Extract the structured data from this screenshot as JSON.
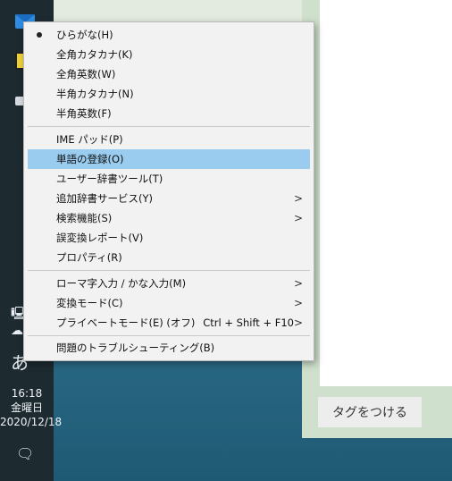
{
  "taskbar": {
    "icons": [
      "mail-icon",
      "sticky-notes-icon",
      "drive-icon"
    ],
    "tray": {
      "ime_label": "あ",
      "time": "16:18",
      "day": "金曜日",
      "date": "2020/12/18"
    }
  },
  "menu": {
    "items": [
      {
        "label": "ひらがな(H)",
        "checked": true
      },
      {
        "label": "全角カタカナ(K)"
      },
      {
        "label": "全角英数(W)"
      },
      {
        "label": "半角カタカナ(N)"
      },
      {
        "label": "半角英数(F)"
      },
      {
        "label": "IME パッド(P)"
      },
      {
        "label": "単語の登録(O)",
        "highlighted": true
      },
      {
        "label": "ユーザー辞書ツール(T)"
      },
      {
        "label": "追加辞書サービス(Y)",
        "submenu": true
      },
      {
        "label": "検索機能(S)",
        "submenu": true
      },
      {
        "label": "誤変換レポート(V)"
      },
      {
        "label": "プロパティ(R)"
      },
      {
        "label": "ローマ字入力 / かな入力(M)",
        "submenu": true
      },
      {
        "label": "変換モード(C)",
        "submenu": true
      },
      {
        "label": "プライベートモード(E) (オフ)",
        "shortcut": "Ctrl + Shift + F10",
        "submenu": true
      },
      {
        "label": "問題のトラブルシューティング(B)"
      }
    ],
    "submenu_arrow": ">",
    "highlight_color": "#99ccee"
  },
  "app": {
    "tag_button_label": "タグをつける"
  }
}
